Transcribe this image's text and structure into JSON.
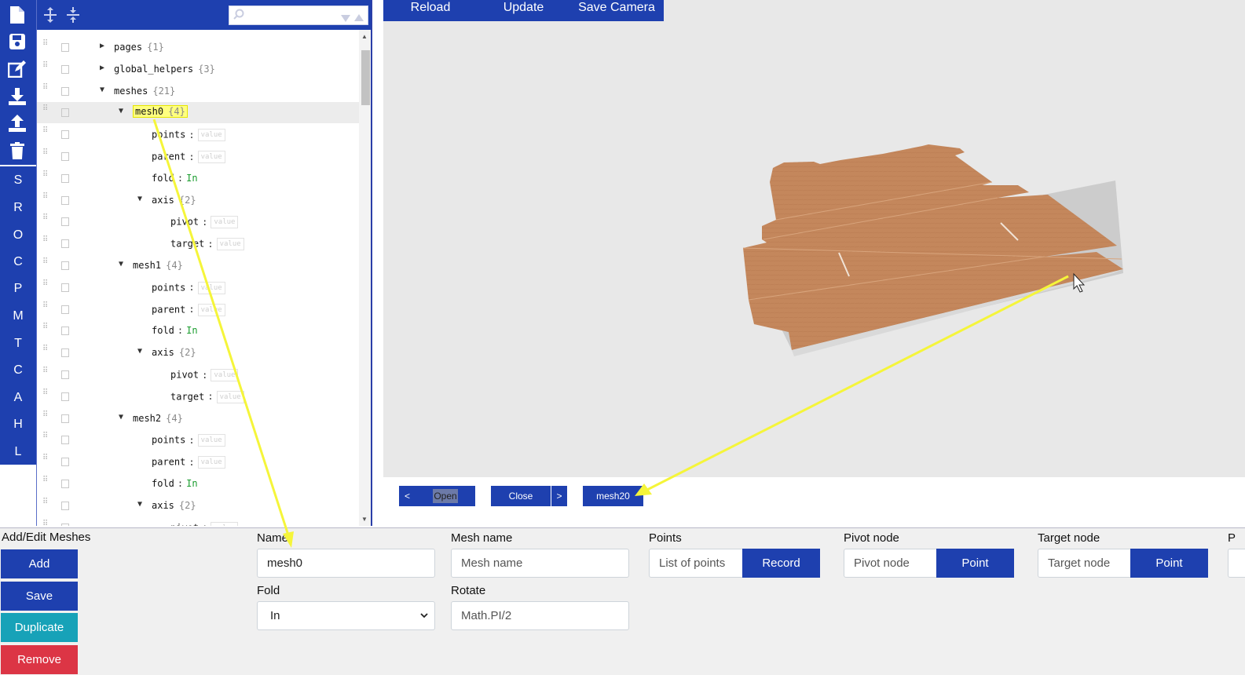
{
  "sidebar": {
    "icons": [
      "file-icon",
      "save-icon",
      "edit-icon",
      "download-icon",
      "upload-icon",
      "trash-icon"
    ],
    "letters": [
      "S",
      "R",
      "O",
      "C",
      "P",
      "M",
      "T",
      "C",
      "A",
      "H",
      "L"
    ]
  },
  "tree": {
    "rows": [
      {
        "key": "pages",
        "count": "{1}",
        "caret": "▶",
        "indent": 0
      },
      {
        "key": "global_helpers",
        "count": "{3}",
        "caret": "▶",
        "indent": 0
      },
      {
        "key": "meshes",
        "count": "{21}",
        "caret": "▼",
        "indent": 0
      },
      {
        "key": "mesh0",
        "count": "{4}",
        "caret": "▼",
        "indent": 1,
        "selected": true
      },
      {
        "key": "points",
        "indent": 2,
        "value": "value"
      },
      {
        "key": "parent",
        "indent": 2,
        "value": "value"
      },
      {
        "key": "fold",
        "indent": 2,
        "text": "In"
      },
      {
        "key": "axis",
        "count": "{2}",
        "caret": "▼",
        "indent": 2
      },
      {
        "key": "pivot",
        "indent": 3,
        "value": "value"
      },
      {
        "key": "target",
        "indent": 3,
        "value": "value"
      },
      {
        "key": "mesh1",
        "count": "{4}",
        "caret": "▼",
        "indent": 1
      },
      {
        "key": "points",
        "indent": 2,
        "value": "value"
      },
      {
        "key": "parent",
        "indent": 2,
        "value": "value"
      },
      {
        "key": "fold",
        "indent": 2,
        "text": "In"
      },
      {
        "key": "axis",
        "count": "{2}",
        "caret": "▼",
        "indent": 2
      },
      {
        "key": "pivot",
        "indent": 3,
        "value": "value"
      },
      {
        "key": "target",
        "indent": 3,
        "value": "value"
      },
      {
        "key": "mesh2",
        "count": "{4}",
        "caret": "▼",
        "indent": 1
      },
      {
        "key": "points",
        "indent": 2,
        "value": "value"
      },
      {
        "key": "parent",
        "indent": 2,
        "value": "value"
      },
      {
        "key": "fold",
        "indent": 2,
        "text": "In"
      },
      {
        "key": "axis",
        "count": "{2}",
        "caret": "▼",
        "indent": 2
      },
      {
        "key": "pivot",
        "indent": 3,
        "value": "value"
      }
    ]
  },
  "viewer": {
    "toolbar": {
      "reload": "Reload",
      "update": "Update",
      "save_camera": "Save Camera"
    }
  },
  "nav": {
    "prev": "<",
    "open": "Open",
    "close": "Close",
    "next": ">",
    "mesh": "mesh20"
  },
  "form": {
    "heading": "Add/Edit Meshes",
    "buttons": {
      "add": "Add",
      "save": "Save",
      "duplicate": "Duplicate",
      "remove": "Remove"
    },
    "name": {
      "label": "Name",
      "value": "mesh0"
    },
    "mesh_name": {
      "label": "Mesh name",
      "placeholder": "Mesh name"
    },
    "points": {
      "label": "Points",
      "placeholder": "List of points",
      "button": "Record"
    },
    "pivot": {
      "label": "Pivot node",
      "placeholder": "Pivot node",
      "button": "Point"
    },
    "target": {
      "label": "Target node",
      "placeholder": "Target node",
      "button": "Point"
    },
    "fold": {
      "label": "Fold",
      "value": "In"
    },
    "rotate": {
      "label": "Rotate",
      "placeholder": "Math.PI/2"
    },
    "cut_label": "P"
  },
  "colors": {
    "primary": "#1e40af",
    "duplicate": "#17a2b8",
    "remove": "#dc3545",
    "cardboard": "#c4875c",
    "annotation": "#f5f53a"
  }
}
